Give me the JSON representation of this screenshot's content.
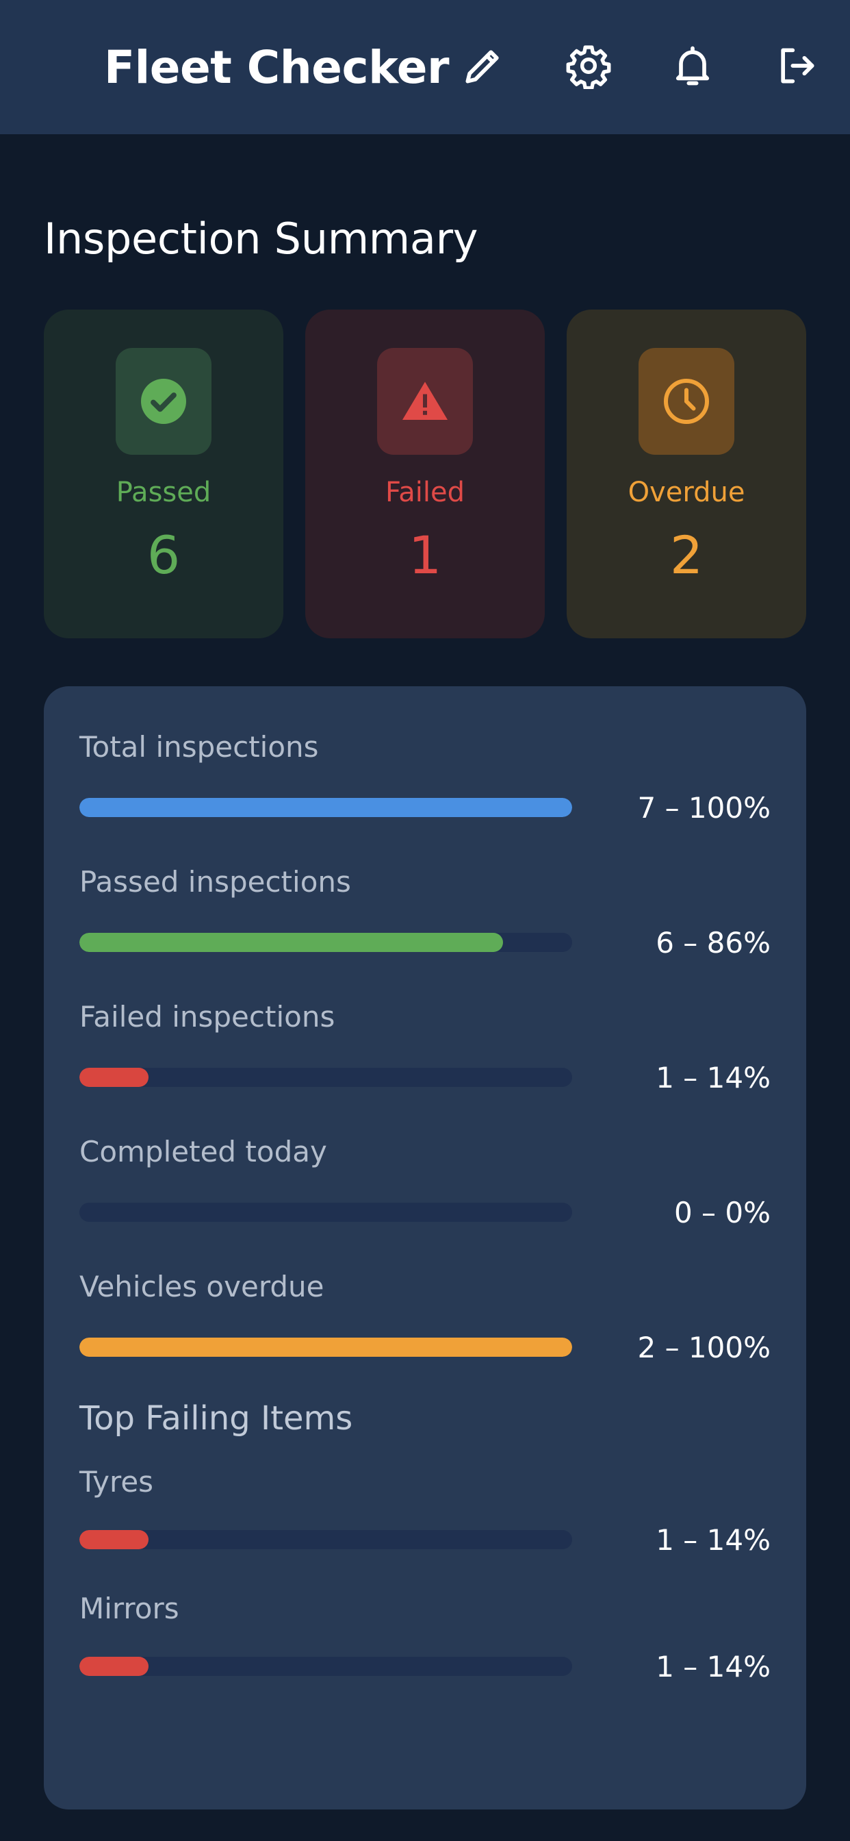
{
  "header": {
    "title": "Fleet Checker",
    "actions": [
      {
        "name": "edit-icon"
      },
      {
        "name": "settings-gear-icon"
      },
      {
        "name": "notification-bell-icon"
      },
      {
        "name": "logout-icon"
      }
    ]
  },
  "summary": {
    "title": "Inspection Summary",
    "cards": {
      "passed": {
        "label": "Passed",
        "count": "6",
        "icon": "check-circle-icon",
        "color": "#5fac57"
      },
      "failed": {
        "label": "Failed",
        "count": "1",
        "icon": "warning-triangle-icon",
        "color": "#e04a47"
      },
      "overdue": {
        "label": "Overdue",
        "count": "2",
        "icon": "clock-icon",
        "color": "#f0a138"
      }
    }
  },
  "stats": [
    {
      "label": "Total inspections",
      "value": "7 – 100%",
      "fraction": 1.0,
      "color": "#4a90e2"
    },
    {
      "label": "Passed inspections",
      "value": "6 – 86%",
      "fraction": 0.86,
      "color": "#5fac57"
    },
    {
      "label": "Failed inspections",
      "value": "1 – 14%",
      "fraction": 0.14,
      "color": "#d9463f"
    },
    {
      "label": "Completed today",
      "value": "0 – 0%",
      "fraction": 0.0,
      "color": "#4a90e2"
    },
    {
      "label": "Vehicles overdue",
      "value": "2 – 100%",
      "fraction": 1.0,
      "color": "#f0a138"
    }
  ],
  "top_failing": {
    "title": "Top Failing Items",
    "items": [
      {
        "label": "Tyres",
        "value": "1 – 14%",
        "fraction": 0.14,
        "color": "#d9463f"
      },
      {
        "label": "Mirrors",
        "value": "1 – 14%",
        "fraction": 0.14,
        "color": "#d9463f"
      }
    ]
  },
  "colors": {
    "background": "#0f1a2a",
    "header": "#223552",
    "panel": "#283a55",
    "track": "#1f3050"
  }
}
